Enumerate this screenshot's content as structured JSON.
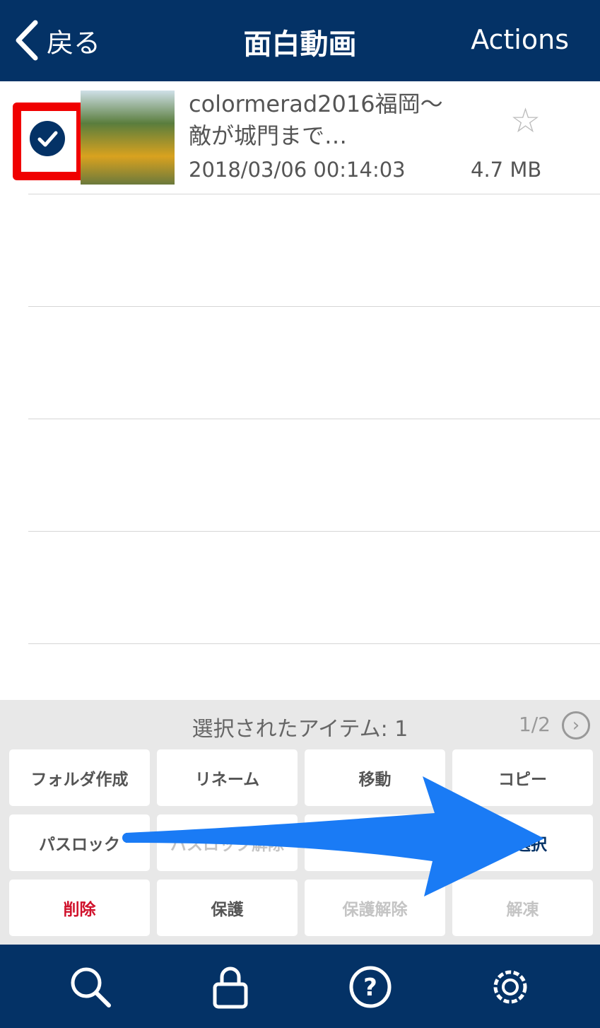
{
  "header": {
    "back_label": "戻る",
    "title": "面白動画",
    "actions_label": "Actions"
  },
  "files": [
    {
      "name": "colormerad2016福岡〜敵が城門まで…",
      "date": "2018/03/06 00:14:03",
      "size": "4.7 MB",
      "selected": true,
      "starred": false
    }
  ],
  "panel": {
    "selected_text": "選択されたアイテム: 1",
    "page": "1/2",
    "buttons": [
      {
        "label": "フォルダ作成",
        "state": "normal"
      },
      {
        "label": "リネーム",
        "state": "normal"
      },
      {
        "label": "移動",
        "state": "normal"
      },
      {
        "label": "コピー",
        "state": "normal"
      },
      {
        "label": "パスロック",
        "state": "normal"
      },
      {
        "label": "パスロック解除",
        "state": "disabled"
      },
      {
        "label": "",
        "state": "normal"
      },
      {
        "label": "非選択",
        "state": "navy"
      },
      {
        "label": "削除",
        "state": "red"
      },
      {
        "label": "保護",
        "state": "normal"
      },
      {
        "label": "保護解除",
        "state": "disabled"
      },
      {
        "label": "解凍",
        "state": "disabled"
      }
    ]
  },
  "tabbar": [
    "search-icon",
    "lock-icon",
    "help-icon",
    "gear-icon"
  ],
  "colors": {
    "navy": "#043266",
    "highlight": "#f00000",
    "arrow": "#1a7bf5",
    "delete": "#d0112b"
  }
}
